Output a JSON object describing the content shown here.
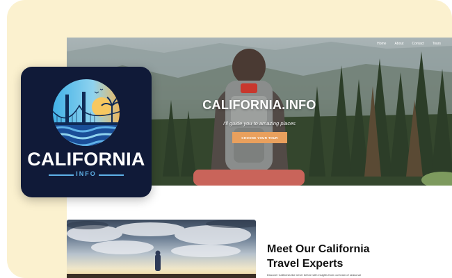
{
  "logo": {
    "wordmark": "CALIFORNIA",
    "sub": "INFO"
  },
  "nav": {
    "items": [
      "Home",
      "About",
      "Contact",
      "Tours"
    ]
  },
  "hero": {
    "title": "CALIFORNIA.INFO",
    "subtitle": "I'll guide you to amazing places",
    "cta_label": "CHOOSE YOUR TOUR"
  },
  "about": {
    "title_line1": "Meet Our California",
    "title_line2": "Travel Experts",
    "body": "Discover California like never before with insights from our team of seasonal"
  },
  "colors": {
    "background_card": "#fbf1cf",
    "logo_background": "#101a38",
    "logo_accent": "#5fb1e8",
    "cta": "#e9a05d"
  }
}
